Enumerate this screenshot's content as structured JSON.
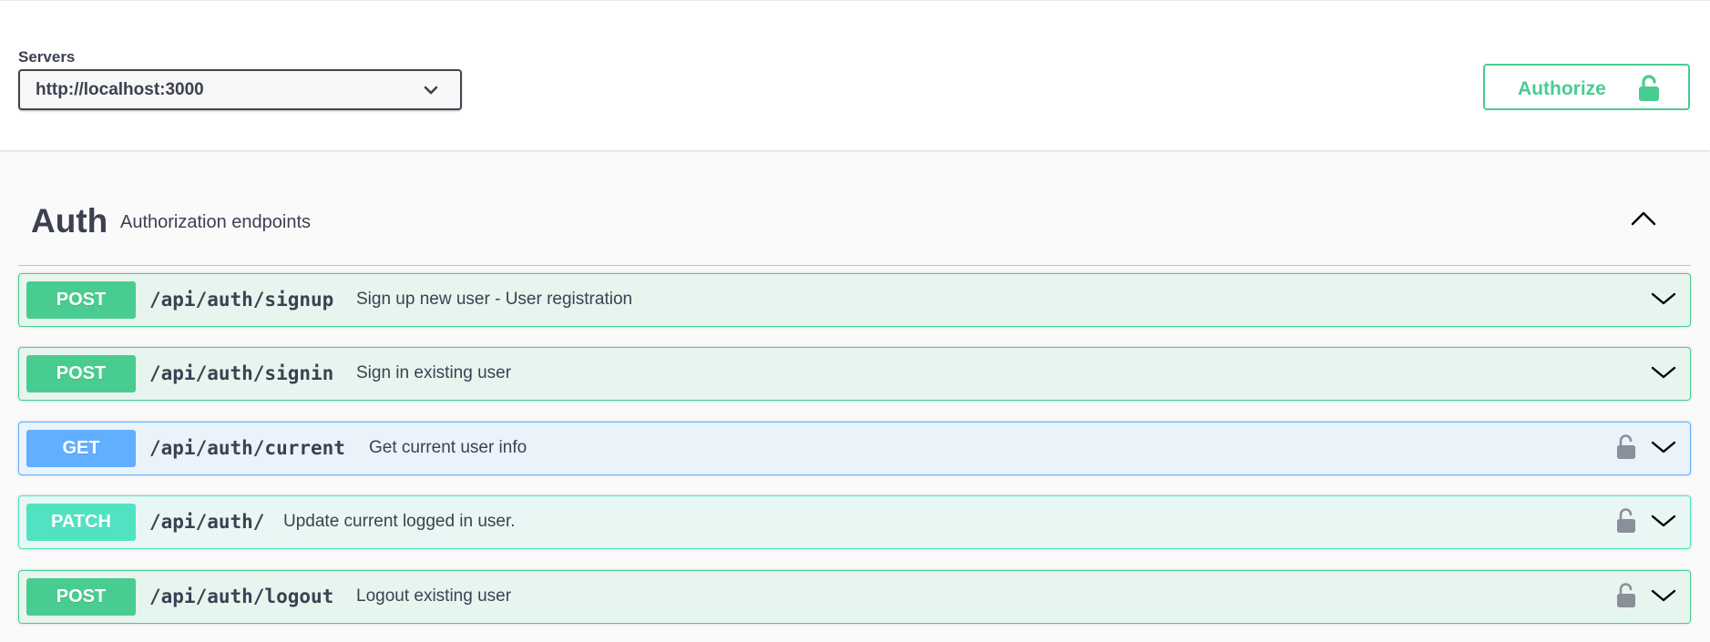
{
  "servers": {
    "label": "Servers",
    "selected": "http://localhost:3000"
  },
  "authorize": {
    "label": "Authorize",
    "icon": "unlocked-lock-icon"
  },
  "tag": {
    "title": "Auth",
    "description": "Authorization endpoints",
    "expanded": true
  },
  "operations": [
    {
      "method": "POST",
      "path": "/api/auth/signup",
      "summary": "Sign up new user - User registration",
      "locked": false
    },
    {
      "method": "POST",
      "path": "/api/auth/signin",
      "summary": "Sign in existing user",
      "locked": false
    },
    {
      "method": "GET",
      "path": "/api/auth/current",
      "summary": "Get current user info",
      "locked": true
    },
    {
      "method": "PATCH",
      "path": "/api/auth/",
      "summary": "Update current logged in user.",
      "locked": true
    },
    {
      "method": "POST",
      "path": "/api/auth/logout",
      "summary": "Logout existing user",
      "locked": true
    }
  ],
  "colors": {
    "post": "#49cc90",
    "get": "#61affe",
    "patch": "#50e3c2",
    "text": "#3b4151"
  }
}
